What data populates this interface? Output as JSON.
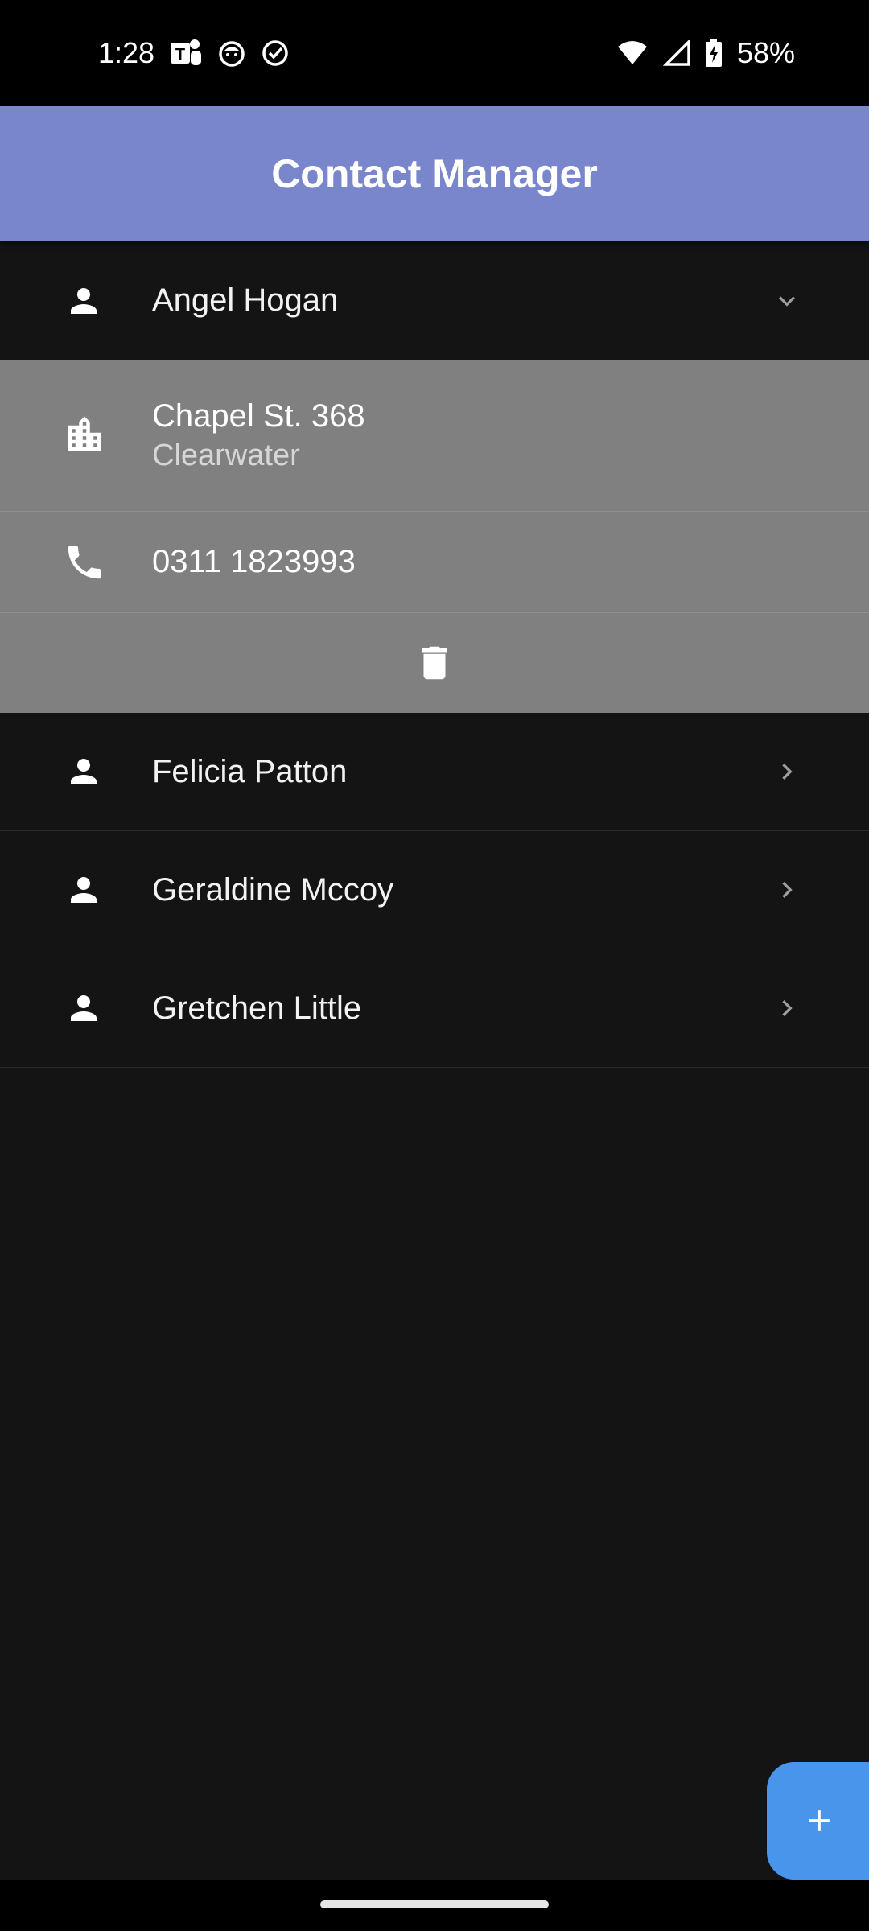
{
  "status_bar": {
    "time": "1:28",
    "battery": "58%",
    "icons": [
      "teams-icon",
      "cat-icon",
      "check-circle-icon",
      "wifi-icon",
      "signal-icon",
      "battery-icon"
    ]
  },
  "app_bar": {
    "title": "Contact Manager"
  },
  "contacts": [
    {
      "name": "Angel Hogan",
      "expanded": true,
      "address_line1": "Chapel St. 368",
      "address_line2": "Clearwater",
      "phone": "0311 1823993"
    },
    {
      "name": "Felicia Patton",
      "expanded": false
    },
    {
      "name": "Geraldine Mccoy",
      "expanded": false
    },
    {
      "name": "Gretchen Little",
      "expanded": false
    }
  ],
  "icons": {
    "person": "person-icon",
    "building": "building-icon",
    "phone": "phone-icon",
    "delete": "trash-icon",
    "expand": "chevron-down-icon",
    "collapse": "chevron-right-icon",
    "add": "plus-icon"
  },
  "colors": {
    "app_bar": "#7986cb",
    "background": "#141414",
    "detail_panel": "#808080",
    "fab": "#4a95ec"
  }
}
